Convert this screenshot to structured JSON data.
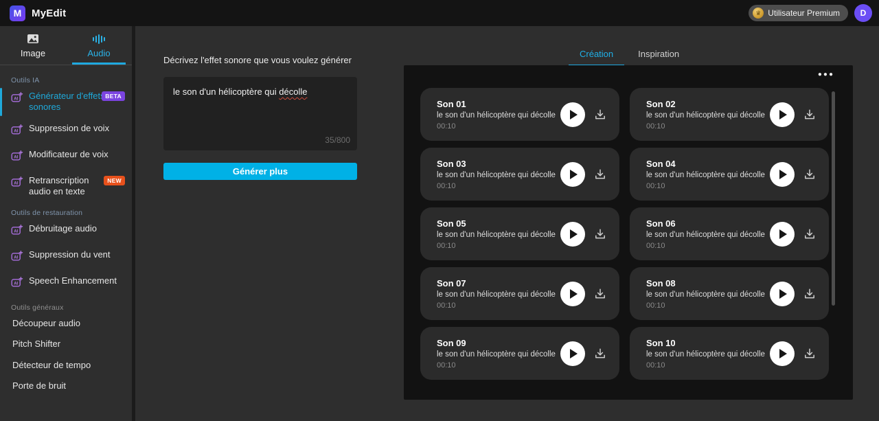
{
  "app": {
    "title": "MyEdit"
  },
  "topbar": {
    "premium_label": "Utilisateur Premium",
    "avatar_initial": "D"
  },
  "sidebar": {
    "tabs": [
      {
        "label": "Image",
        "active": false
      },
      {
        "label": "Audio",
        "active": true
      }
    ],
    "sections": [
      {
        "header": "Outils IA",
        "items": [
          {
            "label": "Générateur d'effets sonores",
            "icon": true,
            "active": true,
            "badge": "BETA"
          },
          {
            "label": "Suppression de voix",
            "icon": true
          },
          {
            "label": "Modificateur de voix",
            "icon": true
          },
          {
            "label": "Retranscription audio en texte",
            "icon": true,
            "badge": "NEW"
          }
        ]
      },
      {
        "header": "Outils de restauration",
        "items": [
          {
            "label": "Débruitage audio",
            "icon": true
          },
          {
            "label": "Suppression du vent",
            "icon": true
          },
          {
            "label": "Speech Enhancement",
            "icon": true
          }
        ]
      },
      {
        "header": "Outils généraux",
        "items": [
          {
            "label": "Découpeur audio"
          },
          {
            "label": "Pitch Shifter"
          },
          {
            "label": "Détecteur de tempo"
          },
          {
            "label": "Porte de bruit"
          }
        ]
      }
    ]
  },
  "generator": {
    "prompt_label": "Décrivez l'effet sonore que vous voulez générer",
    "prompt_text_before": "le son d'un hélicoptère qui ",
    "prompt_misspelled_word": "décolle",
    "char_count": "35/800",
    "generate_button": "Générer plus"
  },
  "results": {
    "tabs": [
      {
        "label": "Création",
        "active": true
      },
      {
        "label": "Inspiration",
        "active": false
      }
    ],
    "more_icon": "●●●",
    "cards": [
      {
        "title": "Son 01",
        "desc": "le son d'un hélicoptère qui décolle",
        "duration": "00:10"
      },
      {
        "title": "Son 02",
        "desc": "le son d'un hélicoptère qui décolle",
        "duration": "00:10"
      },
      {
        "title": "Son 03",
        "desc": "le son d'un hélicoptère qui décolle",
        "duration": "00:10"
      },
      {
        "title": "Son 04",
        "desc": "le son d'un hélicoptère qui décolle",
        "duration": "00:10"
      },
      {
        "title": "Son 05",
        "desc": "le son d'un hélicoptère qui décolle",
        "duration": "00:10"
      },
      {
        "title": "Son 06",
        "desc": "le son d'un hélicoptère qui décolle",
        "duration": "00:10"
      },
      {
        "title": "Son 07",
        "desc": "le son d'un hélicoptère qui décolle",
        "duration": "00:10"
      },
      {
        "title": "Son 08",
        "desc": "le son d'un hélicoptère qui décolle",
        "duration": "00:10"
      },
      {
        "title": "Son 09",
        "desc": "le son d'un hélicoptère qui décolle",
        "duration": "00:10"
      },
      {
        "title": "Son 10",
        "desc": "le son d'un hélicoptère qui décolle",
        "duration": "00:10"
      }
    ]
  },
  "colors": {
    "accent_cyan": "#00b1e6",
    "badge_beta": "#7b44e0",
    "badge_new": "#e8511c",
    "avatar_purple": "#6b4ef5",
    "panel_black": "#121212",
    "card_gray": "#2b2b2b"
  }
}
